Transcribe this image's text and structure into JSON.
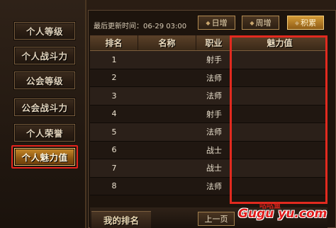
{
  "sidebar": {
    "items": [
      {
        "label": "个人等级"
      },
      {
        "label": "个人战斗力"
      },
      {
        "label": "公会等级"
      },
      {
        "label": "公会战斗力"
      },
      {
        "label": "个人荣誉"
      },
      {
        "label": "个人魅力值",
        "active": true
      }
    ]
  },
  "header": {
    "update_label": "最后更新时间：06-29 03:00",
    "tabs": [
      {
        "label": "日增"
      },
      {
        "label": "周增"
      },
      {
        "label": "积累",
        "active": true
      }
    ]
  },
  "table": {
    "columns": [
      "排名",
      "名称",
      "职业",
      "魅力值"
    ],
    "rows": [
      {
        "rank": "1",
        "name": "",
        "class": "射手",
        "charm": ""
      },
      {
        "rank": "2",
        "name": "",
        "class": "法师",
        "charm": ""
      },
      {
        "rank": "3",
        "name": "",
        "class": "法师",
        "charm": ""
      },
      {
        "rank": "4",
        "name": "",
        "class": "射手",
        "charm": ""
      },
      {
        "rank": "5",
        "name": "",
        "class": "法师",
        "charm": ""
      },
      {
        "rank": "6",
        "name": "",
        "class": "战士",
        "charm": ""
      },
      {
        "rank": "7",
        "name": "",
        "class": "战士",
        "charm": ""
      },
      {
        "rank": "8",
        "name": "",
        "class": "法师",
        "charm": ""
      }
    ]
  },
  "footer": {
    "my_rank_label": "我的排名",
    "prev_page_label": "上一页"
  },
  "watermark": {
    "line1": "咕咕鱼",
    "line2": "Gugu yu.com"
  },
  "colors": {
    "highlight": "#e22a1f",
    "active_gold": "#c88b2a"
  }
}
